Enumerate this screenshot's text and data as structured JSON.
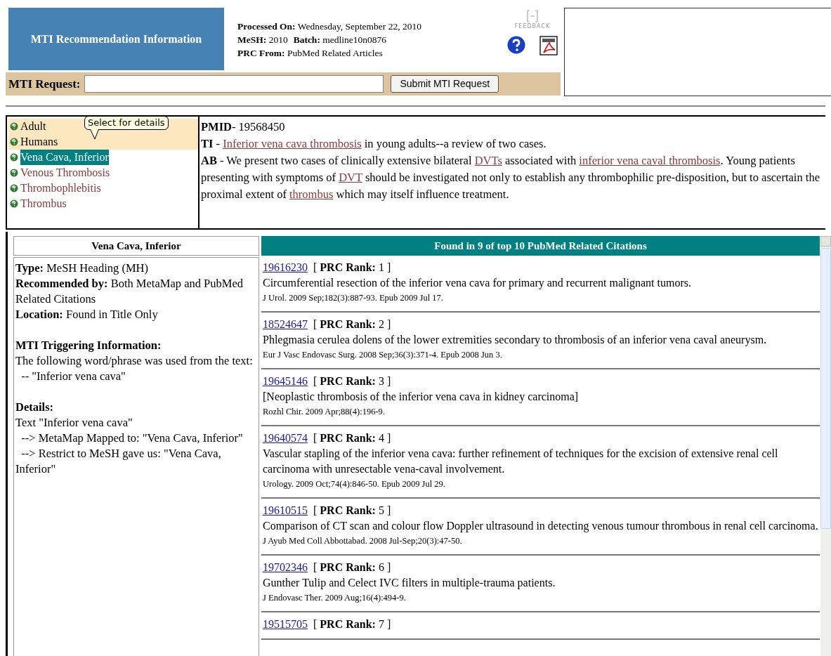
{
  "header": {
    "title": "MTI Recommendation Information",
    "info": [
      {
        "label": "Processed On:",
        "value": "Wednesday, September 22, 2010"
      },
      {
        "label": "MeSH:",
        "value": "2010",
        "label2": "Batch:",
        "value2": "medline10n0876"
      },
      {
        "label": "PRC From:",
        "value": "PubMed Related Articles"
      }
    ],
    "feedback": "FEEDBACK"
  },
  "request": {
    "label": "MTI Request:",
    "button": "Submit MTI Request"
  },
  "terms": [
    {
      "label": "Adult",
      "highlighted": true,
      "selected": false
    },
    {
      "label": "Humans",
      "highlighted": true,
      "selected": false
    },
    {
      "label": "Vena Cava, Inferior",
      "highlighted": false,
      "selected": true
    },
    {
      "label": "Venous Thrombosis",
      "highlighted": false,
      "selected": false
    },
    {
      "label": "Thrombophlebitis",
      "highlighted": false,
      "selected": false
    },
    {
      "label": "Thrombus",
      "highlighted": false,
      "selected": false
    }
  ],
  "tooltip": "Select for details",
  "abstract": {
    "pmid_label": "PMID",
    "pmid": "- 19568450",
    "fields": [
      {
        "label": "TI",
        "segments": [
          {
            "kind": "text",
            "text": " - "
          },
          {
            "kind": "link",
            "text": "Inferior vena cava thrombosis"
          },
          {
            "kind": "text",
            "text": " in young adults--a review of two cases."
          }
        ]
      },
      {
        "label": "AB",
        "segments": [
          {
            "kind": "text",
            "text": " - We present two cases of clinically extensive bilateral "
          },
          {
            "kind": "link",
            "text": "DVTs"
          },
          {
            "kind": "text",
            "text": " associated with "
          },
          {
            "kind": "link",
            "text": "inferior vena caval thrombosis"
          },
          {
            "kind": "text",
            "text": ". Young patients presenting with symptoms of "
          },
          {
            "kind": "link",
            "text": "DVT"
          },
          {
            "kind": "text",
            "text": " should be investigated not only to establish any thrombophilic pre-disposition, but to ascertain the proximal extent of "
          },
          {
            "kind": "link",
            "text": "thrombus"
          },
          {
            "kind": "text",
            "text": " which may itself influence treatment."
          }
        ]
      }
    ]
  },
  "detail": {
    "title": "Vena Cava, Inferior",
    "sections": [
      {
        "lines": [
          "**Type:** MeSH Heading (MH)",
          "**Recommended by:** Both MetaMap and PubMed Related Citations",
          "**Location:** Found in Title Only"
        ]
      },
      {
        "heading": "MTI Triggering Information:",
        "lines": [
          "The following word/phrase was used from the text:",
          "  -- \"Inferior vena cava\""
        ]
      },
      {
        "heading": "Details:",
        "lines": [
          "Text \"Inferior vena cava\"",
          "  --> MetaMap Mapped to: \"Vena Cava, Inferior\"",
          "  --> Restrict to MeSH gave us: \"Vena Cava, Inferior\""
        ]
      }
    ]
  },
  "citations": {
    "title": "Found in 9 of top 10 PubMed Related Citations",
    "items": [
      {
        "pmid": "19616230",
        "rank": "[ **PRC Rank:** 1 ]",
        "title": "Circumferential resection of the inferior vena cava for primary and recurrent malignant tumors.",
        "source": "J Urol. 2009 Sep;182(3):887-93. Epub 2009 Jul 17."
      },
      {
        "pmid": "18524647",
        "rank": "[ **PRC Rank:** 2 ]",
        "title": "Phlegmasia cerulea dolens of the lower extremities secondary to thrombosis of an inferior vena caval aneurysm.",
        "source": "Eur J Vasc Endovasc Surg. 2008 Sep;36(3):371-4. Epub 2008 Jun 3."
      },
      {
        "pmid": "19645146",
        "rank": "[ **PRC Rank:** 3 ]",
        "title": "[Neoplastic thrombosis of the inferior vena cava in kidney carcinoma]",
        "source": "Rozhl Chir. 2009 Apr;88(4):196-9."
      },
      {
        "pmid": "19640574",
        "rank": "[ **PRC Rank:** 4 ]",
        "title": "Vascular stapling of the inferior vena cava: further refinement of techniques for the excision of extensive renal cell carcinoma with unresectable vena-caval involvement.",
        "source": "Urology. 2009 Oct;74(4):846-50. Epub 2009 Jul 29."
      },
      {
        "pmid": "19610515",
        "rank": "[ **PRC Rank:** 5 ]",
        "title": "Comparison of CT scan and colour flow Doppler ultrasound in detecting venous tumour thrombous in renal cell carcinoma.",
        "source": "J Ayub Med Coll Abbottabad. 2008 Jul-Sep;20(3):47-50."
      },
      {
        "pmid": "19702346",
        "rank": "[ **PRC Rank:** 6 ]",
        "title": "Gunther Tulip and Celect IVC filters in multiple-trauma patients.",
        "source": "J Endovasc Ther. 2009 Aug;16(4):494-9."
      },
      {
        "pmid": "19515705",
        "rank": "[ **PRC Rank:** 7 ]"
      }
    ]
  }
}
